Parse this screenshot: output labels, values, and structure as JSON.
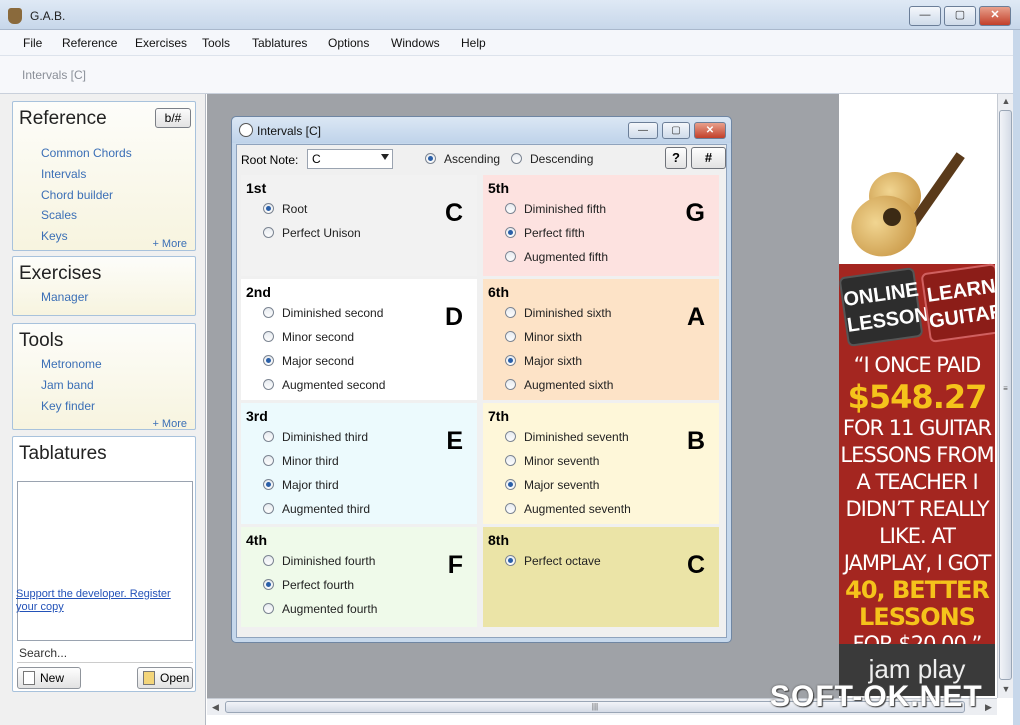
{
  "window": {
    "title": "G.A.B.",
    "controls": [
      "—",
      "▢",
      "✕"
    ]
  },
  "menu": [
    "File",
    "Reference",
    "Exercises",
    "Tools",
    "Tablatures",
    "Options",
    "Windows",
    "Help"
  ],
  "toolbar": {
    "breadcrumb": "Intervals [C]"
  },
  "sidebar": {
    "reference": {
      "title": "Reference",
      "toggle": "b/#",
      "links": [
        "Common Chords",
        "Intervals",
        "Chord builder",
        "Scales",
        "Keys"
      ],
      "more": "+ More"
    },
    "exercises": {
      "title": "Exercises",
      "links": [
        "Manager"
      ]
    },
    "tools": {
      "title": "Tools",
      "links": [
        "Metronome",
        "Jam band",
        "Key finder"
      ],
      "more": "+ More"
    },
    "tablatures": {
      "title": "Tablatures",
      "search_placeholder": "Search...",
      "new": "New",
      "open": "Open"
    },
    "support": "Support the developer. Register your copy"
  },
  "child": {
    "title": "Intervals [C]",
    "root_label": "Root Note:",
    "root_value": "C",
    "ascending": "Ascending",
    "descending": "Descending",
    "direction_selected": "Ascending",
    "help": "?",
    "sharp": "#",
    "intervals": [
      {
        "degree": "1st",
        "note": "C",
        "color": "#f2f2f2",
        "options": [
          "Root",
          "Perfect Unison"
        ],
        "selected": 0
      },
      {
        "degree": "5th",
        "note": "G",
        "color": "#fde2e0",
        "options": [
          "Diminished fifth",
          "Perfect fifth",
          "Augmented fifth"
        ],
        "selected": 1
      },
      {
        "degree": "2nd",
        "note": "D",
        "color": "#ffffff",
        "options": [
          "Diminished second",
          "Minor second",
          "Major second",
          "Augmented second"
        ],
        "selected": 2
      },
      {
        "degree": "6th",
        "note": "A",
        "color": "#fde3c7",
        "options": [
          "Diminished sixth",
          "Minor sixth",
          "Major sixth",
          "Augmented sixth"
        ],
        "selected": 2
      },
      {
        "degree": "3rd",
        "note": "E",
        "color": "#ecfafd",
        "options": [
          "Diminished third",
          "Minor third",
          "Major third",
          "Augmented third"
        ],
        "selected": 2
      },
      {
        "degree": "7th",
        "note": "B",
        "color": "#fef7d9",
        "options": [
          "Diminished seventh",
          "Minor seventh",
          "Major seventh",
          "Augmented seventh"
        ],
        "selected": 2
      },
      {
        "degree": "4th",
        "note": "F",
        "color": "#effaea",
        "options": [
          "Diminished fourth",
          "Perfect fourth",
          "Augmented fourth"
        ],
        "selected": 1
      },
      {
        "degree": "8th",
        "note": "C",
        "color": "#ebe4a7",
        "options": [
          "Perfect octave"
        ],
        "selected": 0
      }
    ]
  },
  "ad": {
    "badge1": "ONLINE LESSONS",
    "badge2": "LEARN GUITAR",
    "quote_line1": "“I ONCE PAID",
    "price": "$548.27",
    "quote_line2": "FOR 11 GUITAR LESSONS FROM A TEACHER I DIDN’T REALLY LIKE. AT JAMPLAY, I GOT",
    "highlight": "40, BETTER LESSONS",
    "quote_line3": "FOR $20.00.”",
    "brand": "jam play"
  },
  "watermark": "SOFT-OK.NET"
}
